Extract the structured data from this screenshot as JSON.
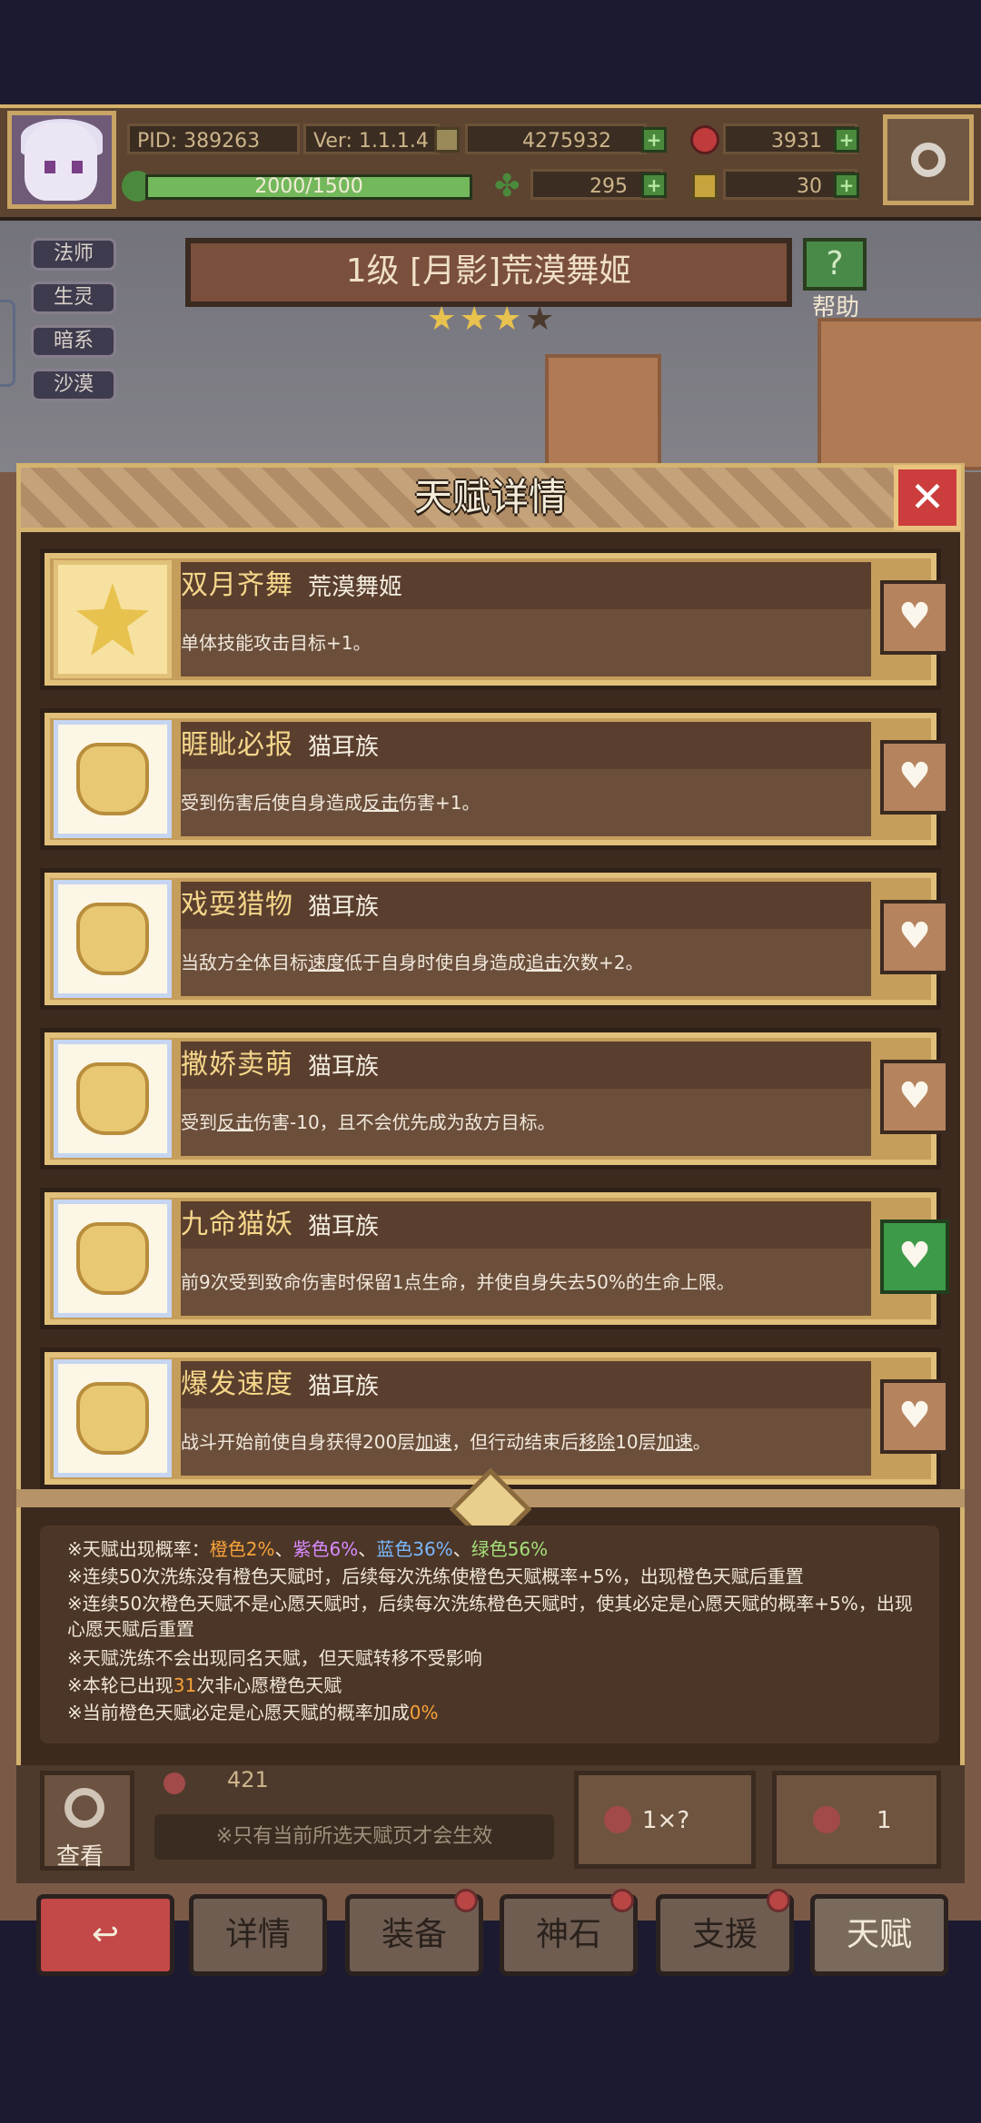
{
  "topbar": {
    "pid": "PID: 389263",
    "version": "Ver: 1.1.1.4",
    "coins": "4275932",
    "gems": "3931",
    "exp": "2000/1500",
    "clover": "295",
    "key": "30"
  },
  "tags": [
    "法师",
    "生灵",
    "暗系",
    "沙漠"
  ],
  "character_title": "1级 [月影]荒漠舞姬",
  "stars": 3,
  "help_label": "帮助",
  "dialog": {
    "title": "天赋详情",
    "talents": [
      {
        "name": "双月齐舞",
        "race": "荒漠舞姬",
        "desc": [
          "单体技能攻击目标+1。"
        ],
        "heart": "tan",
        "icon": "star-icon"
      },
      {
        "name": "睚眦必报",
        "race": "猫耳族",
        "desc": [
          "受到伤害后使自身造成",
          "反击",
          "伤害+1。"
        ],
        "heart": "tan",
        "icon": "cat-icon"
      },
      {
        "name": "戏耍猎物",
        "race": "猫耳族",
        "desc": [
          "当敌方全体目标",
          "速度",
          "低于自身时使自身造成",
          "追击",
          "次数+2。"
        ],
        "heart": "tan",
        "icon": "cat-icon"
      },
      {
        "name": "撒娇卖萌",
        "race": "猫耳族",
        "desc": [
          "受到",
          "反击",
          "伤害-10，且不会优先成为敌方目标。"
        ],
        "heart": "tan",
        "icon": "cat-icon"
      },
      {
        "name": "九命猫妖",
        "race": "猫耳族",
        "desc": [
          "前9次受到致命伤害时保留1点生命，并使自身失去50%的生命上限。"
        ],
        "heart": "green",
        "icon": "cat-icon"
      },
      {
        "name": "爆发速度",
        "race": "猫耳族",
        "desc": [
          "战斗开始前使自身获得200层",
          "加速",
          "，但行动结束后",
          "移除",
          "10层",
          "加速",
          "。"
        ],
        "heart": "tan",
        "icon": "cat-icon"
      }
    ],
    "notes": {
      "line1_prefix": "※天赋出现概率：",
      "orange": "橙色2%",
      "sep1": "、",
      "purple": "紫色6%",
      "sep2": "、",
      "blue": "蓝色36%",
      "sep3": "、",
      "green": "绿色56%",
      "line2": "※连续50次洗练没有橙色天赋时，后续每次洗练使橙色天赋概率+5%，出现橙色天赋后重置",
      "line3": "※连续50次橙色天赋不是心愿天赋时，后续每次洗练橙色天赋时，使其必定是心愿天赋的概率+5%，出现心愿天赋后重置",
      "line4": "※天赋洗练不会出现同名天赋，但天赋转移不受影响",
      "line5_prefix": "※本轮已出现",
      "line5_count": "31",
      "line5_suffix": "次非心愿橙色天赋",
      "line6_prefix": "※当前橙色天赋必定是心愿天赋的概率加成",
      "line6_value": "0%"
    }
  },
  "bottom": {
    "count": "421",
    "search_label": "查看",
    "hint": "※只有当前所选天赋页才会生效",
    "auto_refine_count": "1×?",
    "refine_count": "1"
  },
  "nav": [
    "详情",
    "装备",
    "神石",
    "支援",
    "天赋"
  ],
  "colors": {
    "accent_gold": "#d3b36f",
    "orange": "#f7a23a",
    "purple": "#d78bff",
    "blue": "#7ab8ff",
    "green": "#a4e07a"
  }
}
